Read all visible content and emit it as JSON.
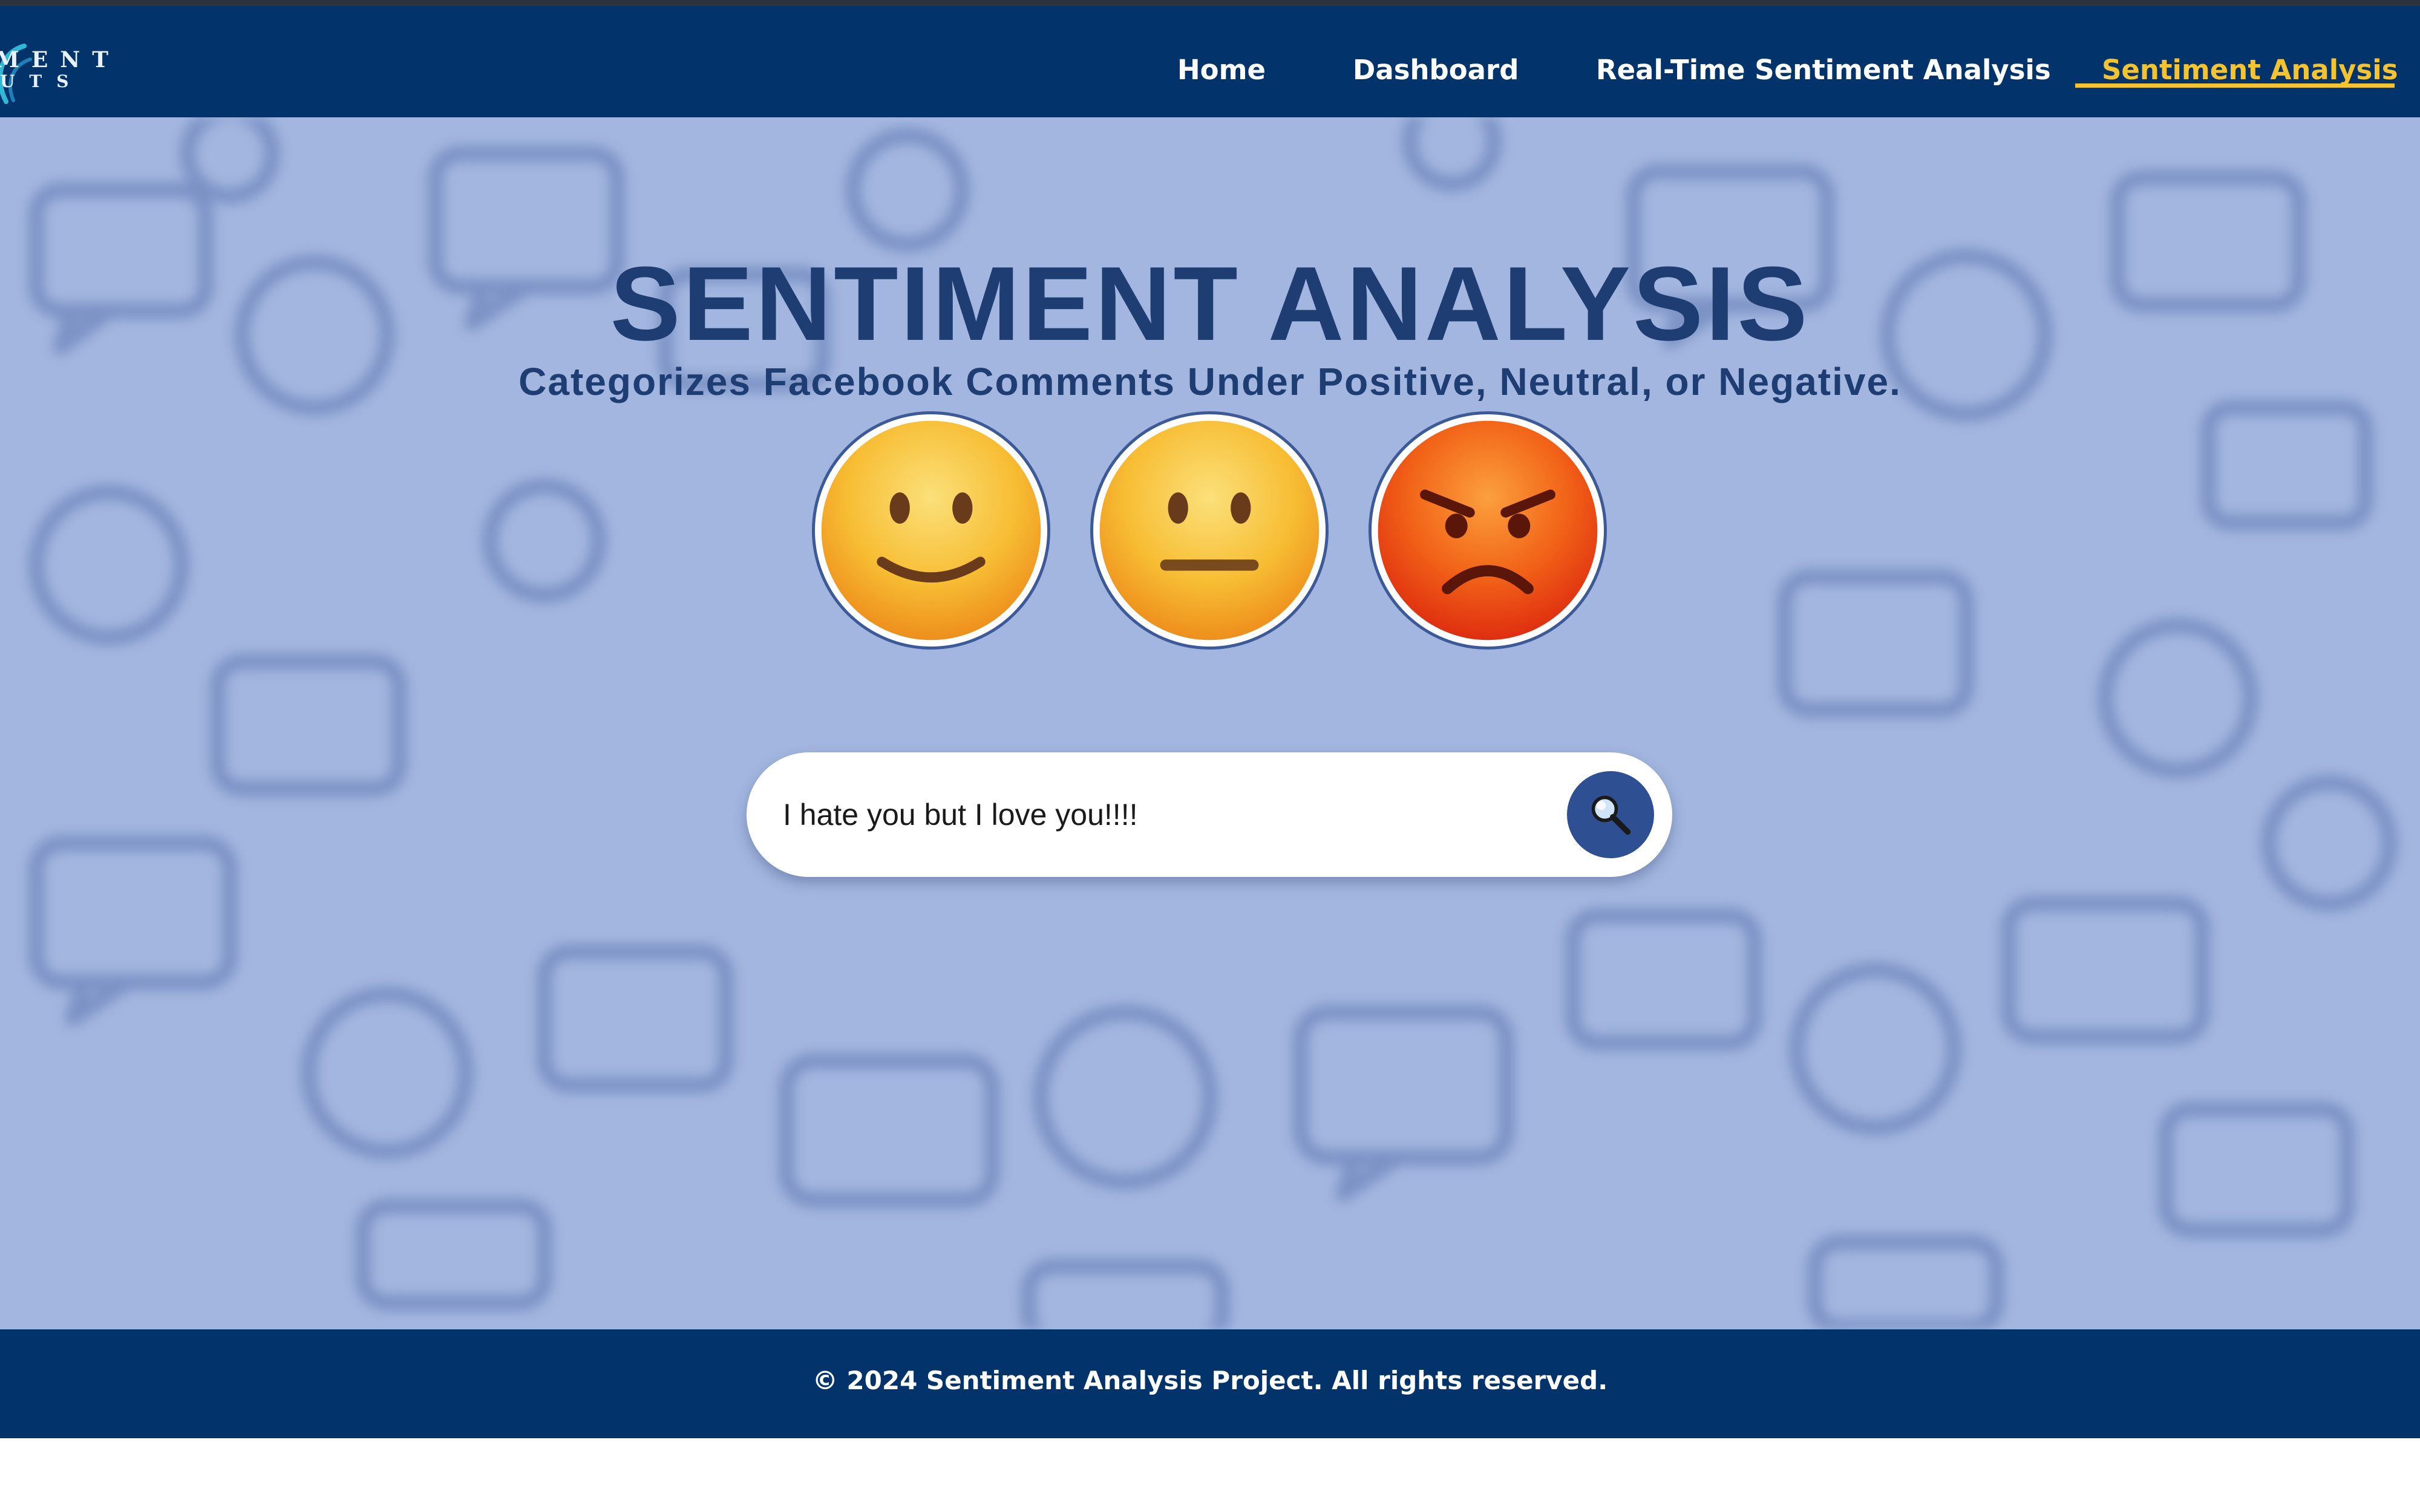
{
  "header": {
    "logo": {
      "line1": "MENT",
      "line2": "UTS"
    },
    "nav": [
      {
        "label": "Home"
      },
      {
        "label": "Dashboard"
      },
      {
        "label": "Real-Time Sentiment Analysis"
      },
      {
        "label": "Sentiment Analysis",
        "active": true
      }
    ],
    "active_color": "#f5c330"
  },
  "main": {
    "title": "SENTIMENT ANALYSIS",
    "subtitle": "Categorizes Facebook Comments Under Positive, Neutral, or Negative.",
    "emojis": [
      "slightly-smiling-face-icon",
      "neutral-face-icon",
      "angry-face-icon"
    ],
    "search": {
      "value": "I hate you but I love you!!!!",
      "button_icon": "search-icon"
    }
  },
  "footer": {
    "text": "© 2024 Sentiment Analysis Project. All rights reserved."
  },
  "colors": {
    "nav_bg": "#02346b",
    "page_bg": "#a2b6df",
    "title": "#1e3d72",
    "button": "#2f4f93"
  }
}
